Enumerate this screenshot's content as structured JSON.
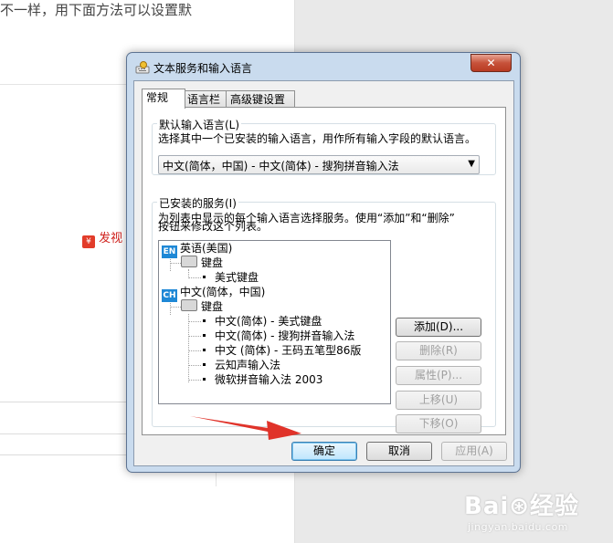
{
  "background": {
    "top_text": "不一样，用下面方法可以设置默",
    "share_label": "发视",
    "close_mark": "×"
  },
  "watermark": {
    "logo": "Bai⊛经验",
    "url": "jingyan.baidu.com"
  },
  "dialog": {
    "title": "文本服务和输入语言",
    "close_glyph": "✕",
    "tabs": [
      {
        "label": "常规",
        "active": true
      },
      {
        "label": "语言栏",
        "active": false
      },
      {
        "label": "高级键设置",
        "active": false
      }
    ],
    "default_language": {
      "group_label": "默认输入语言(L)",
      "description": "选择其中一个已安装的输入语言，用作所有输入字段的默认语言。",
      "selected": "中文(简体，中国) - 中文(简体) - 搜狗拼音输入法",
      "arrow": "▼"
    },
    "installed_services": {
      "group_label": "已安装的服务(I)",
      "description_line1": "为列表中显示的每个输入语言选择服务。使用“添加”和“删除”",
      "description_line2": "按钮来修改这个列表。",
      "tree": {
        "lang1": {
          "badge": "EN",
          "name": "英语(美国)"
        },
        "lang1_keyboard_label": "键盘",
        "lang1_items": [
          "美式键盘"
        ],
        "lang2": {
          "badge": "CH",
          "name": "中文(简体，中国)"
        },
        "lang2_keyboard_label": "键盘",
        "lang2_items": [
          "中文(简体) - 美式键盘",
          "中文(简体) - 搜狗拼音输入法",
          "中文 (简体) - 王码五笔型86版",
          "云知声输入法",
          "微软拼音输入法 2003"
        ]
      },
      "buttons": {
        "add": "添加(D)...",
        "remove": "删除(R)",
        "properties": "属性(P)...",
        "move_up": "上移(U)",
        "move_down": "下移(O)"
      }
    },
    "footer": {
      "ok": "确定",
      "cancel": "取消",
      "apply": "应用(A)"
    }
  },
  "colors": {
    "dialog_frame": "#c9dbee",
    "close_button": "#c7523a",
    "annotation_arrow": "#e0332a"
  }
}
